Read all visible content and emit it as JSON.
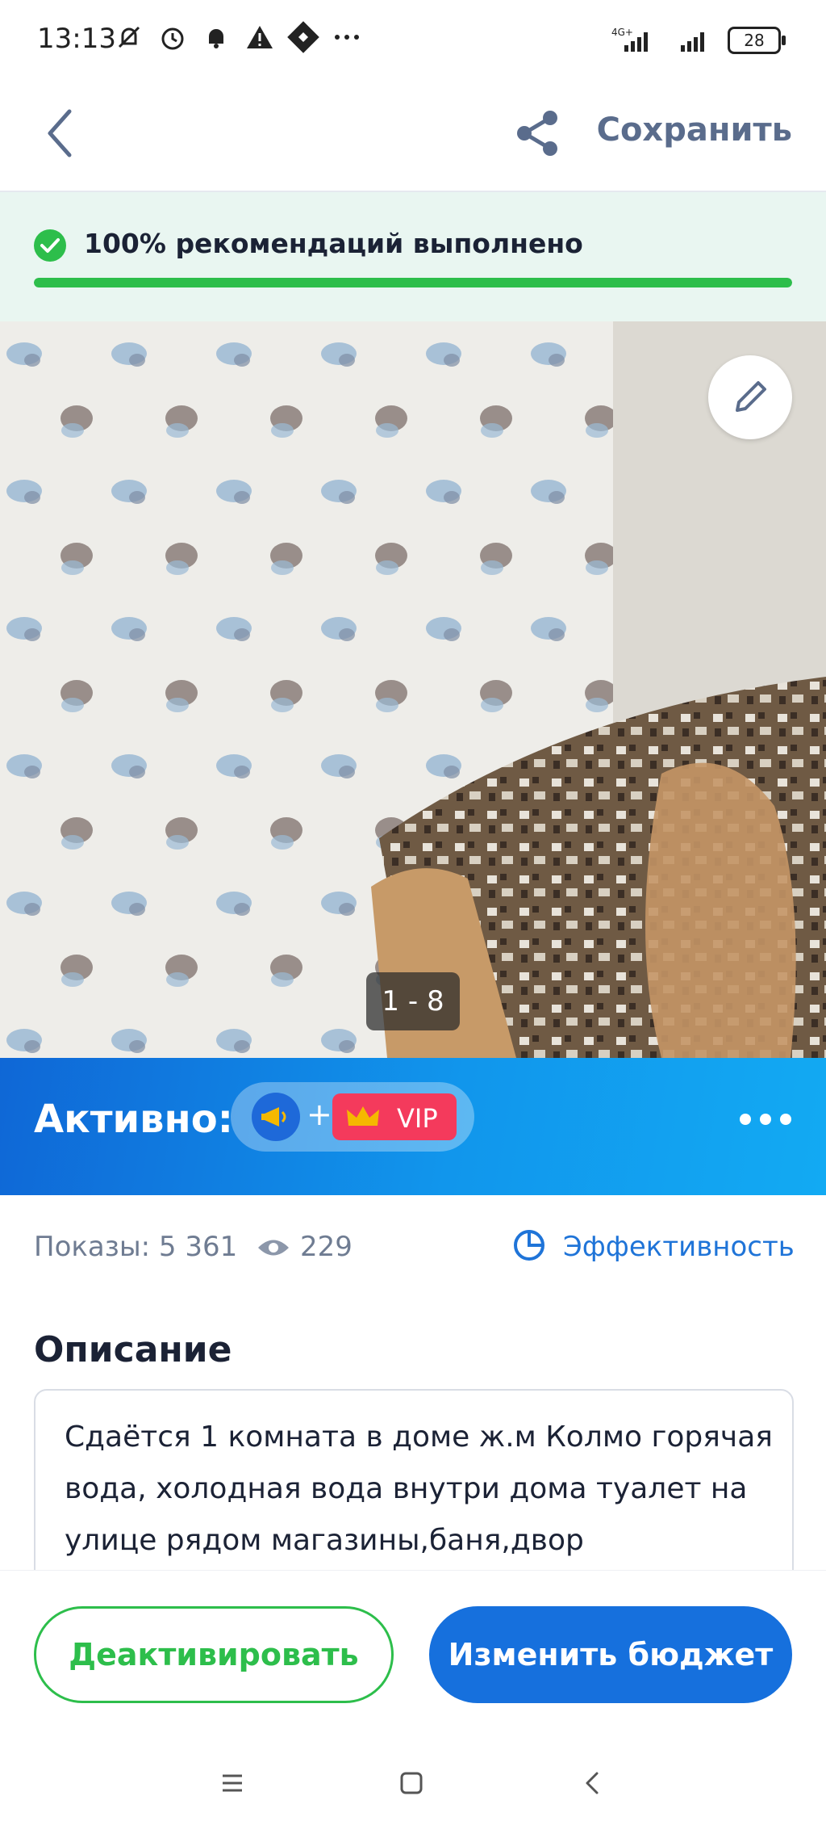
{
  "status_bar": {
    "time": "13:13",
    "network": "4G+",
    "battery": "28"
  },
  "app_bar": {
    "save_label": "Сохранить"
  },
  "recommendations": {
    "text": "100% рекомендаций выполнено",
    "progress_percent": 100,
    "color": "#2dbe4b"
  },
  "photo": {
    "counter": "1 - 8"
  },
  "active": {
    "label": "Активно:",
    "plus": "+",
    "vip_label": "VIP"
  },
  "stats": {
    "shows": "Показы: 5 361",
    "views": "229",
    "efficiency_label": "Эффективность"
  },
  "description": {
    "title": "Описание",
    "text": "Сдаётся 1 комната в доме ж.м Колмо горячая вода, холодная вода внутри дома туалет на улице рядом магазины,баня,двор"
  },
  "actions": {
    "deactivate_label": "Деактивировать",
    "change_budget_label": "Изменить бюджет"
  },
  "colors": {
    "accent_blue": "#1670dd",
    "accent_green": "#2dbe4b",
    "vip_red": "#f43a5c"
  }
}
